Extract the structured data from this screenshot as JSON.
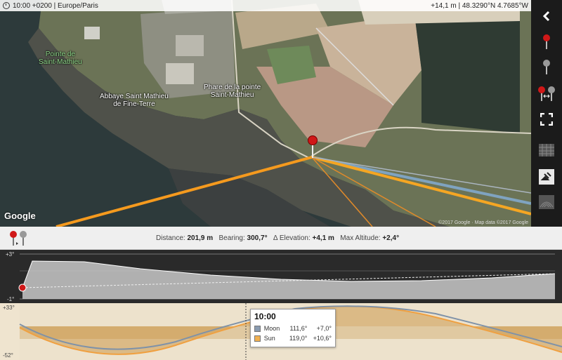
{
  "status": {
    "time": "10:00 +0200 | Europe/Paris",
    "position": "+14,1 m | 48.3290°N 4.7685°W"
  },
  "map": {
    "labels": [
      {
        "text": "Pointe de\nSaint-Mathieu",
        "style": "green"
      },
      {
        "text": "Abbaye Saint Mathieu\nde Fine-Terre",
        "style": "white"
      },
      {
        "text": "Phare de la pointe\nSaint-Mathieu",
        "style": "white"
      }
    ],
    "logo": "Google",
    "copyright": "©2017 Google · Map data ©2017 Google"
  },
  "toolbar": {
    "items": [
      "back-icon",
      "red-pin-icon",
      "grey-pin-icon",
      "pin-pair-icon",
      "fullscreen-icon",
      "grid-layer-icon",
      "satellite-icon",
      "contour-layer-icon"
    ]
  },
  "info": {
    "distance_label": "Distance:",
    "distance_value": "201,9 m",
    "bearing_label": "Bearing:",
    "bearing_value": "300,7°",
    "elevation_label": "Δ Elevation:",
    "elevation_value": "+4,1 m",
    "maxalt_label": "Max Altitude:",
    "maxalt_value": "+2,4°"
  },
  "profile": {
    "y_top": "+3°",
    "y_bottom": "-1°"
  },
  "astro": {
    "y_top": "+33°",
    "y_bottom": "-52°",
    "tooltip": {
      "time": "10:00",
      "rows": [
        {
          "name": "Moon",
          "azimuth": "111,6°",
          "altitude": "+7,0°",
          "color": "#8a9bb0"
        },
        {
          "name": "Sun",
          "azimuth": "119,0°",
          "altitude": "+10,6°",
          "color": "#f0b050"
        }
      ]
    }
  },
  "colors": {
    "sun_line": "#f59a1e",
    "moon_line": "#7fa3c0",
    "pin": "#d01818"
  }
}
